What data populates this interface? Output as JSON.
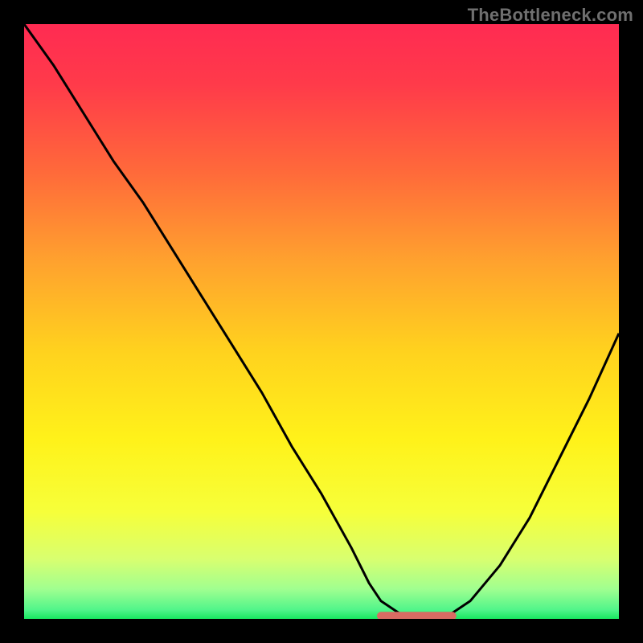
{
  "watermark": "TheBottleneck.com",
  "gradient_stops": [
    {
      "offset": 0.0,
      "color": "#ff2b52"
    },
    {
      "offset": 0.1,
      "color": "#ff3a4a"
    },
    {
      "offset": 0.25,
      "color": "#ff6a3a"
    },
    {
      "offset": 0.4,
      "color": "#ffa22e"
    },
    {
      "offset": 0.55,
      "color": "#ffd21e"
    },
    {
      "offset": 0.7,
      "color": "#fff21a"
    },
    {
      "offset": 0.82,
      "color": "#f6ff3a"
    },
    {
      "offset": 0.9,
      "color": "#d8ff70"
    },
    {
      "offset": 0.95,
      "color": "#a0ff90"
    },
    {
      "offset": 0.985,
      "color": "#50f58a"
    },
    {
      "offset": 1.0,
      "color": "#18e860"
    }
  ],
  "chart_data": {
    "type": "line",
    "title": "",
    "xlabel": "",
    "ylabel": "",
    "x": [
      0.0,
      0.05,
      0.1,
      0.15,
      0.2,
      0.25,
      0.3,
      0.35,
      0.4,
      0.45,
      0.5,
      0.55,
      0.58,
      0.6,
      0.63,
      0.66,
      0.7,
      0.72,
      0.75,
      0.8,
      0.85,
      0.9,
      0.95,
      1.0
    ],
    "values": [
      1.0,
      0.93,
      0.85,
      0.77,
      0.7,
      0.62,
      0.54,
      0.46,
      0.38,
      0.29,
      0.21,
      0.12,
      0.06,
      0.03,
      0.01,
      0.0,
      0.0,
      0.01,
      0.03,
      0.09,
      0.17,
      0.27,
      0.37,
      0.48
    ],
    "xlim": [
      0,
      1
    ],
    "ylim": [
      0,
      1
    ],
    "flat_region": {
      "x_start": 0.6,
      "x_end": 0.72,
      "y": 0.005
    },
    "flat_region_style": {
      "color": "#d96b63",
      "width": 10,
      "cap": "round"
    }
  }
}
